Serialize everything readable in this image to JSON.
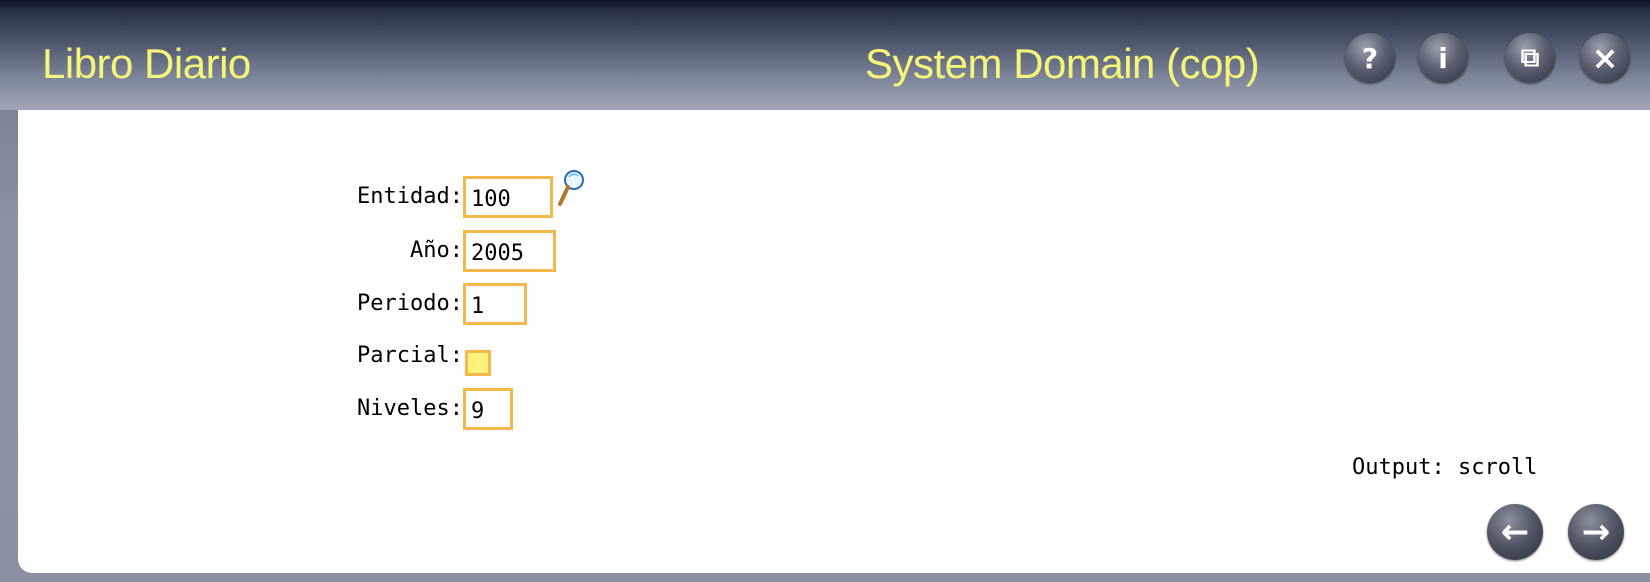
{
  "window": {
    "title": "Libro Diario",
    "domain": "System Domain (cop)",
    "buttons": {
      "help_icon": "?",
      "info_icon": "i",
      "restore_icon": "⧉",
      "close_icon": "×"
    }
  },
  "form": {
    "entidad": {
      "label": "Entidad:",
      "value": "100"
    },
    "anio": {
      "label": "Año:",
      "value": "2005"
    },
    "periodo": {
      "label": "Periodo:",
      "value": "1"
    },
    "parcial": {
      "label": "Parcial:",
      "checked": false
    },
    "niveles": {
      "label": "Niveles:",
      "value": "9"
    }
  },
  "output": {
    "label": "Output: scroll"
  },
  "nav": {
    "back_icon": "←",
    "forward_icon": "→"
  },
  "colors": {
    "title_text": "#f5f57a",
    "field_border": "#f3b94a",
    "checkbox_fill": "#fff27a"
  }
}
